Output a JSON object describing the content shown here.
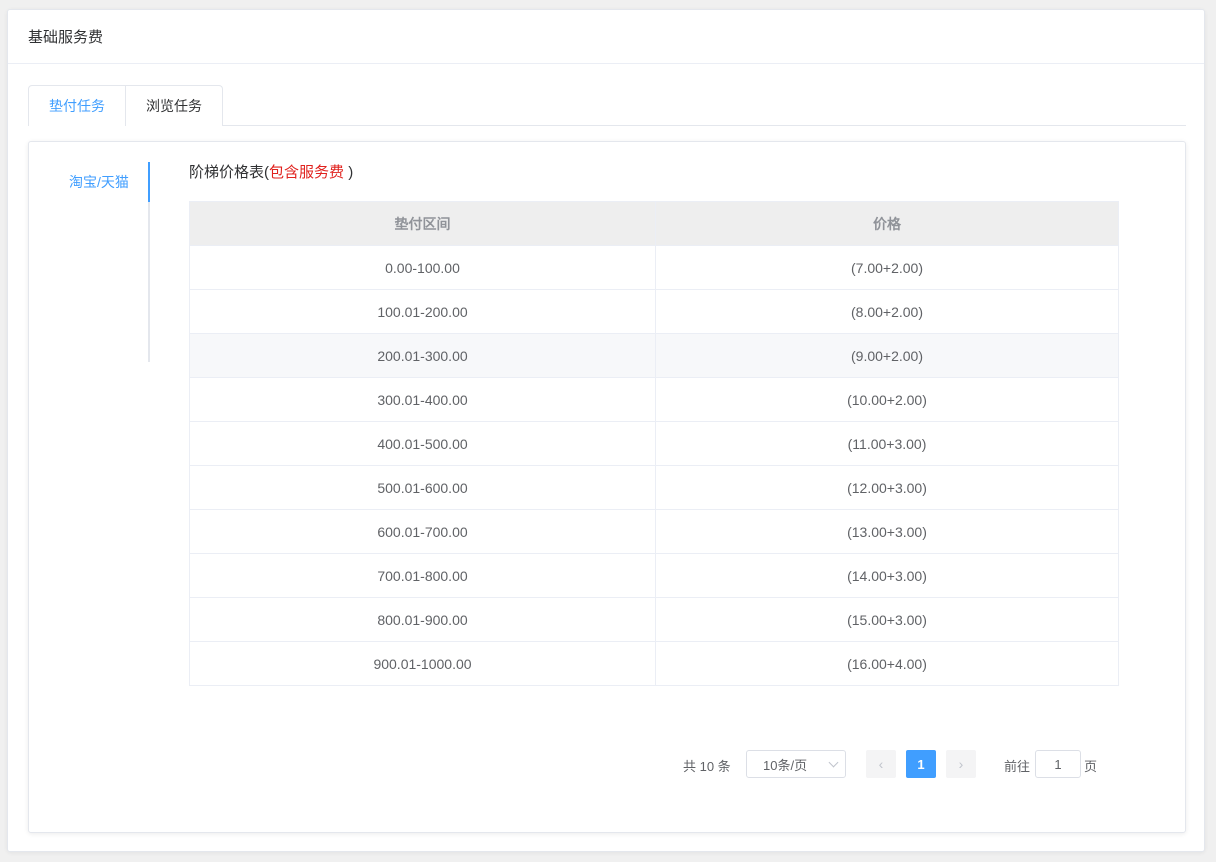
{
  "header": {
    "title": "基础服务费"
  },
  "tabs": [
    {
      "label": "垫付任务",
      "active": true
    },
    {
      "label": "浏览任务",
      "active": false
    }
  ],
  "side_tabs": [
    {
      "label": "淘宝/天猫",
      "active": true
    }
  ],
  "section": {
    "title_prefix": "阶梯价格表(",
    "title_highlight": "包含服务费",
    "title_suffix": ")"
  },
  "table": {
    "headers": [
      "垫付区间",
      "价格"
    ],
    "rows": [
      [
        "0.00-100.00",
        "(7.00+2.00)"
      ],
      [
        "100.01-200.00",
        "(8.00+2.00)"
      ],
      [
        "200.01-300.00",
        "(9.00+2.00)"
      ],
      [
        "300.01-400.00",
        "(10.00+2.00)"
      ],
      [
        "400.01-500.00",
        "(11.00+3.00)"
      ],
      [
        "500.01-600.00",
        "(12.00+3.00)"
      ],
      [
        "600.01-700.00",
        "(13.00+3.00)"
      ],
      [
        "700.01-800.00",
        "(14.00+3.00)"
      ],
      [
        "800.01-900.00",
        "(15.00+3.00)"
      ],
      [
        "900.01-1000.00",
        "(16.00+4.00)"
      ]
    ]
  },
  "pagination": {
    "total": "共 10 条",
    "page_size": "10条/页",
    "current_page": "1",
    "goto_label": "前往",
    "goto_value": "1",
    "goto_suffix": "页"
  },
  "colors": {
    "accent": "#409eff",
    "highlight_red": "#e0221e"
  }
}
